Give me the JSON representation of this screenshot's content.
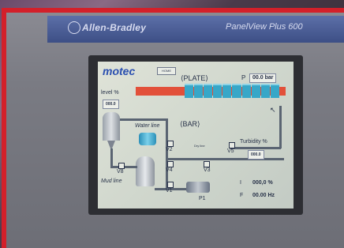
{
  "panel": {
    "brand": "Allen-Bradley",
    "model": "PanelView Plus 600"
  },
  "hmi": {
    "logo": "motec",
    "home_label": "HOME",
    "plate_label": "⟨PLATE⟩",
    "bar_label": "⟨BAR⟩",
    "pressure_label": "P",
    "pressure_value": "00.0 bar",
    "level_label": "level %",
    "level_value": "000.0",
    "water_line_label": "Water line",
    "mud_line_label": "Mud line",
    "turbidity_label": "Turbidity %",
    "turbidity_value": "000.0",
    "current_label": "I",
    "current_value": "000,0 %",
    "frequency_label": "F",
    "frequency_value": "00.00 Hz",
    "valves": [
      "V1",
      "V2",
      "V3",
      "V4",
      "V5",
      "V8"
    ],
    "pump_label": "P1",
    "small_label": "Dry line"
  },
  "colors": {
    "frame_red": "#d3202a",
    "plate_red": "#e2503a",
    "plate_cyan": "#37a7c8",
    "screen_bg": "#dfe3d8",
    "logo_blue": "#2a4fb0"
  }
}
